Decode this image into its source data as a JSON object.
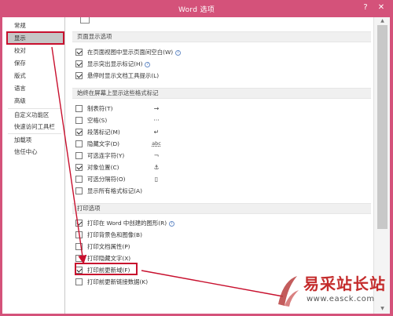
{
  "window": {
    "title": "Word 选项",
    "help_glyph": "?",
    "close_glyph": "✕"
  },
  "sidebar": {
    "items": [
      {
        "label": "常规"
      },
      {
        "label": "显示"
      },
      {
        "label": "校对"
      },
      {
        "label": "保存"
      },
      {
        "label": "版式"
      },
      {
        "label": "语言"
      },
      {
        "label": "高级"
      },
      {
        "label": "自定义功能区"
      },
      {
        "label": "快速访问工具栏"
      },
      {
        "label": "加载项"
      },
      {
        "label": "信任中心"
      }
    ],
    "selected": "显示"
  },
  "sections": {
    "page_display": {
      "header": "页面显示选项",
      "options": [
        {
          "label": "在页面视图中显示页面间空白(W)",
          "checked": true,
          "info": true
        },
        {
          "label": "显示突出显示标记(H)",
          "checked": true,
          "info": true
        },
        {
          "label": "悬停时显示文档工具提示(L)",
          "checked": true,
          "info": false
        }
      ]
    },
    "format_marks": {
      "header": "始终在屏幕上显示这些格式标记",
      "options": [
        {
          "label": "制表符(T)",
          "checked": false,
          "symbol": "→"
        },
        {
          "label": "空格(S)",
          "checked": false,
          "symbol": "···"
        },
        {
          "label": "段落标记(M)",
          "checked": true,
          "symbol": "↵"
        },
        {
          "label": "隐藏文字(D)",
          "checked": false,
          "symbol": "abc"
        },
        {
          "label": "可选连字符(Y)",
          "checked": false,
          "symbol": "¬"
        },
        {
          "label": "对象位置(C)",
          "checked": true,
          "symbol": "⚓"
        },
        {
          "label": "可选分隔符(O)",
          "checked": false,
          "symbol": "▯"
        },
        {
          "label": "显示所有格式标记(A)",
          "checked": false,
          "symbol": ""
        }
      ]
    },
    "print": {
      "header": "打印选项",
      "options": [
        {
          "label": "打印在 Word 中创建的图形(R)",
          "checked": true,
          "info": true
        },
        {
          "label": "打印背景色和图像(B)",
          "checked": false,
          "info": false
        },
        {
          "label": "打印文档属性(P)",
          "checked": false,
          "info": false
        },
        {
          "label": "打印隐藏文字(X)",
          "checked": false,
          "info": false
        },
        {
          "label": "打印前更新域(F)",
          "checked": true,
          "info": false
        },
        {
          "label": "打印前更新链接数据(K)",
          "checked": false,
          "info": false
        }
      ]
    }
  },
  "watermark": {
    "chinese": "易采站长站",
    "url": "www.easck.com"
  },
  "colors": {
    "title_bar": "#d4527a",
    "annotation_red": "#c8102e",
    "selected_item": "#c6c6c6"
  }
}
